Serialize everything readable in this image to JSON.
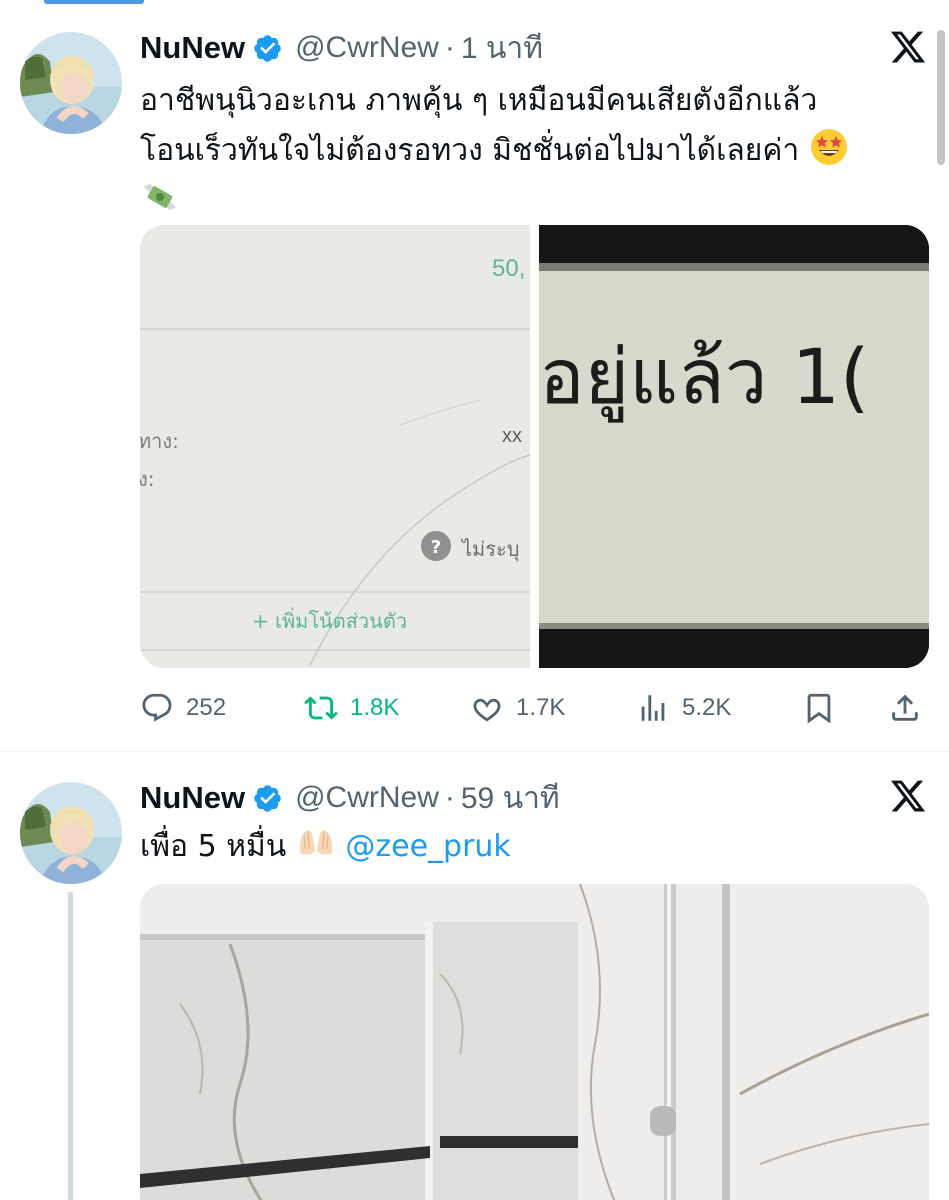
{
  "tweets": [
    {
      "display_name": "NuNew",
      "handle": "@CwrNew",
      "separator": "·",
      "time": "1 นาที",
      "text_lines": [
        "อาชีพนุนิวอะเกน ภาพคุ้น ๆ เหมือนมีคนเสียตังอีกแล้ว",
        "โอนเร็วทันใจไม่ต้องรอทวง มิชชั่นต่อไปมาได้เลยค่า"
      ],
      "emoji": [
        "star-struck",
        "money-with-wings"
      ],
      "media": {
        "left_image": {
          "amount_fragment": "50,",
          "label_1": "ทาง:",
          "value_1": "xx",
          "label_2": "ง:",
          "unspecified": "ไม่ระบุ",
          "add_note": "+ เพิ่มโน้ตส่วนตัว"
        },
        "right_image": {
          "text": "อยู่แล้ว 1("
        }
      },
      "actions": {
        "replies": "252",
        "retweets": "1.8K",
        "likes": "1.7K",
        "views": "5.2K"
      }
    },
    {
      "display_name": "NuNew",
      "handle": "@CwrNew",
      "separator": "·",
      "time": "59 นาที",
      "text": "เพื่อ 5 หมื่น",
      "emoji": [
        "palms-up-together"
      ],
      "mention": "@zee_pruk"
    }
  ],
  "colors": {
    "verified_blue": "#1d9bf0",
    "retweet_green": "#00ba7c",
    "secondary_text": "#536471",
    "mention_blue": "#1d9bf0"
  }
}
